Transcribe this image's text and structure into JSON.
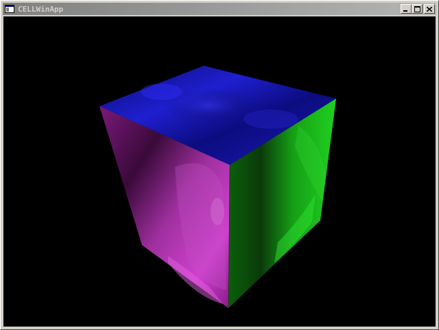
{
  "window": {
    "title": "CELLWinApp",
    "icon": "app-window-icon",
    "controls": [
      "minimize-icon",
      "maximize-icon",
      "close-icon"
    ]
  },
  "viewport": {
    "background": "#000000",
    "content": "textured-cube",
    "faces": {
      "top": {
        "color": "#1a1ac8"
      },
      "left": {
        "color": "#b020b0"
      },
      "right": {
        "color": "#20c020"
      }
    }
  }
}
